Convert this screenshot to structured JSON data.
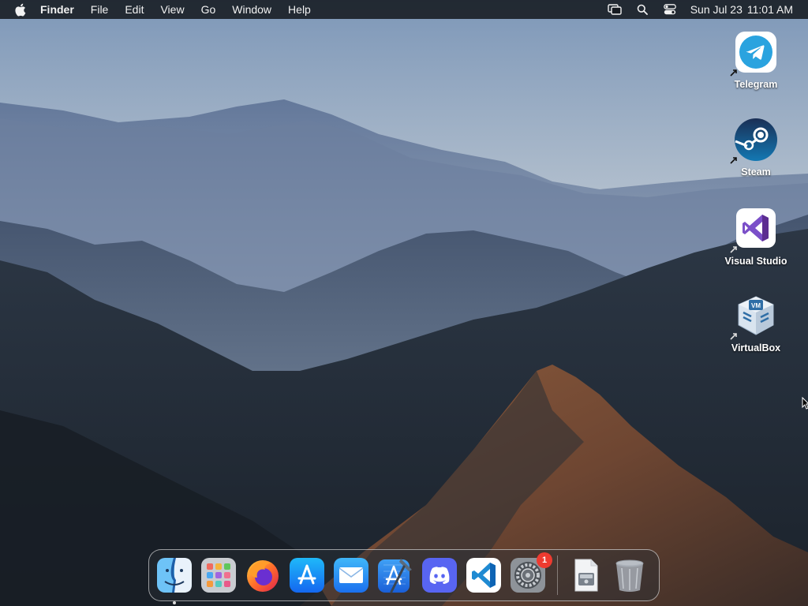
{
  "menubar": {
    "app_name": "Finder",
    "menus": [
      "File",
      "Edit",
      "View",
      "Go",
      "Window",
      "Help"
    ],
    "status_icons": [
      "screen-mirroring-icon",
      "spotlight-search-icon",
      "control-center-icon"
    ],
    "date": "Sun Jul 23",
    "time": "11:01 AM"
  },
  "desktop": {
    "icons": [
      {
        "label": "Telegram",
        "icon": "telegram-icon",
        "color": "#2aa3df"
      },
      {
        "label": "Steam",
        "icon": "steam-icon",
        "color": "#1b3b63"
      },
      {
        "label": "Visual Studio",
        "icon": "visual-studio-icon",
        "color": "#7b4fc9"
      },
      {
        "label": "VirtualBox",
        "icon": "virtualbox-icon",
        "color": "#2f6ea6"
      }
    ]
  },
  "dock": {
    "apps": [
      {
        "name": "Finder",
        "icon": "finder-icon",
        "running": true
      },
      {
        "name": "Launchpad",
        "icon": "launchpad-icon"
      },
      {
        "name": "Firefox",
        "icon": "firefox-icon"
      },
      {
        "name": "App Store",
        "icon": "app-store-icon"
      },
      {
        "name": "Mail",
        "icon": "mail-icon"
      },
      {
        "name": "Xcode",
        "icon": "xcode-icon"
      },
      {
        "name": "Discord",
        "icon": "discord-icon"
      },
      {
        "name": "Visual Studio Code",
        "icon": "vscode-icon"
      },
      {
        "name": "System Preferences",
        "icon": "system-preferences-icon",
        "badge": "1"
      }
    ],
    "others": [
      {
        "name": "Downloads",
        "icon": "downloads-stack-icon"
      },
      {
        "name": "Trash",
        "icon": "trash-icon"
      }
    ],
    "badge_color": "#ee3b30"
  }
}
